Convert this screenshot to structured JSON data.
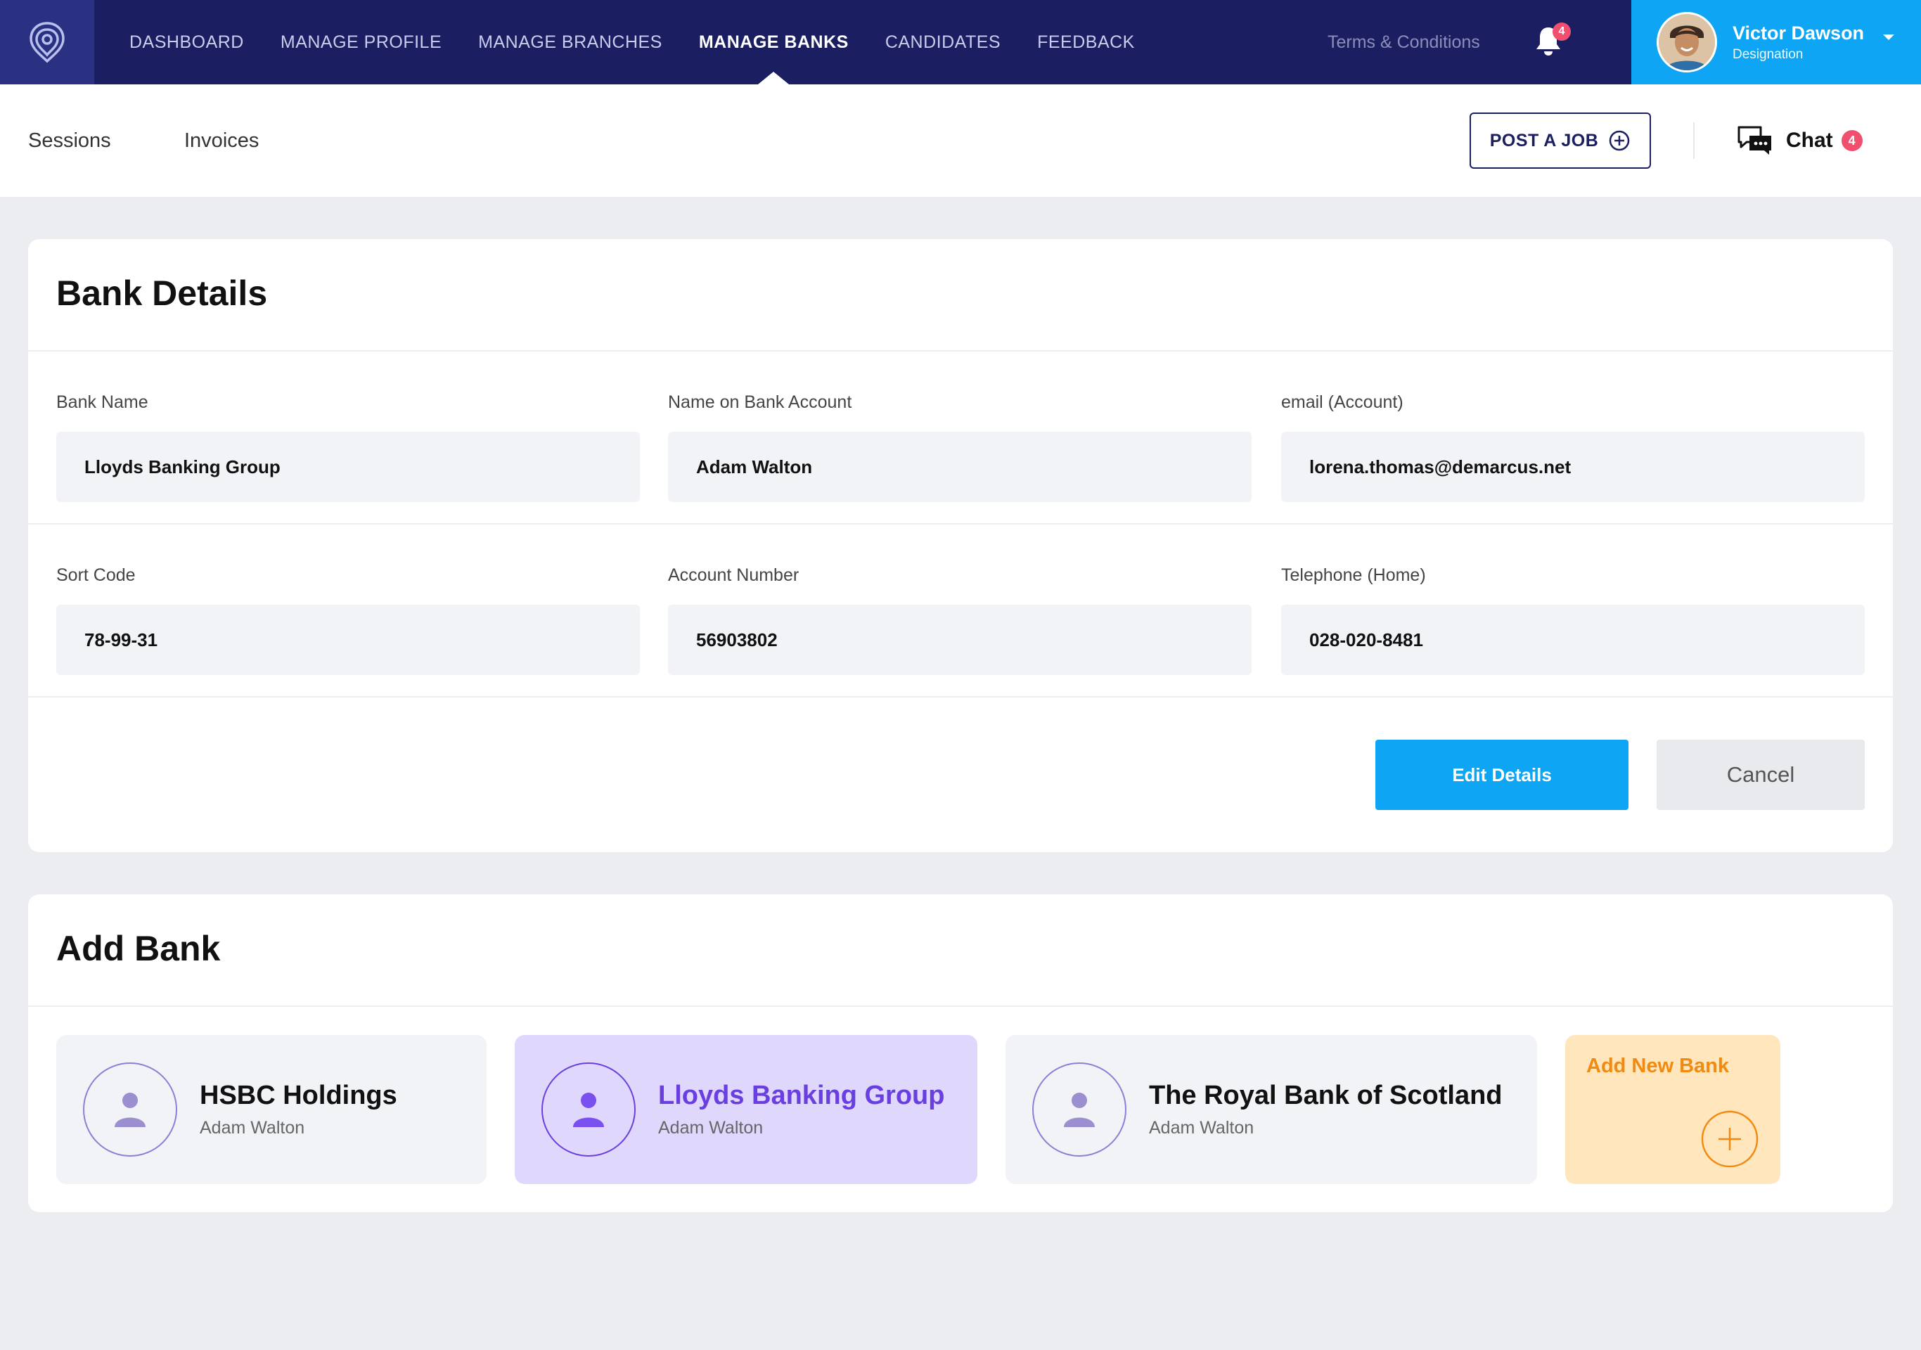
{
  "nav": {
    "logo": "location-pin-logo",
    "items": [
      {
        "label": "DASHBOARD",
        "active": false
      },
      {
        "label": "MANAGE PROFILE",
        "active": false
      },
      {
        "label": "MANAGE BRANCHES",
        "active": false
      },
      {
        "label": "MANAGE BANKS",
        "active": true
      },
      {
        "label": "CANDIDATES",
        "active": false
      },
      {
        "label": "FEEDBACK",
        "active": false
      }
    ],
    "terms_label": "Terms & Conditions",
    "notification_count": "4",
    "user": {
      "name": "Victor Dawson",
      "role": "Designation"
    }
  },
  "subnav": {
    "links": [
      "Sessions",
      "Invoices"
    ],
    "post_job_label": "POST A JOB",
    "chat_label": "Chat",
    "chat_count": "4"
  },
  "bank_details": {
    "title": "Bank Details",
    "fields": {
      "bank_name": {
        "label": "Bank Name",
        "value": "Lloyds Banking Group"
      },
      "account_name": {
        "label": "Name on Bank Account",
        "value": "Adam Walton"
      },
      "email": {
        "label": "email (Account)",
        "value": "lorena.thomas@demarcus.net"
      },
      "sort_code": {
        "label": "Sort Code",
        "value": "78-99-31"
      },
      "account_number": {
        "label": "Account Number",
        "value": "56903802"
      },
      "telephone": {
        "label": "Telephone (Home)",
        "value": "028-020-8481"
      }
    },
    "edit_label": "Edit Details",
    "cancel_label": "Cancel"
  },
  "add_bank": {
    "title": "Add Bank",
    "banks": [
      {
        "name": "HSBC Holdings",
        "holder": "Adam Walton",
        "selected": false
      },
      {
        "name": "Lloyds Banking Group",
        "holder": "Adam Walton",
        "selected": true
      },
      {
        "name": "The Royal Bank of Scotland",
        "holder": "Adam Walton",
        "selected": false
      }
    ],
    "add_new_label": "Add New Bank"
  },
  "colors": {
    "nav_bg": "#1B1F62",
    "accent_blue": "#0EA5F4",
    "selected_purple": "#6A3FE0",
    "add_orange": "#F08A10",
    "badge_red": "#F0506E"
  }
}
